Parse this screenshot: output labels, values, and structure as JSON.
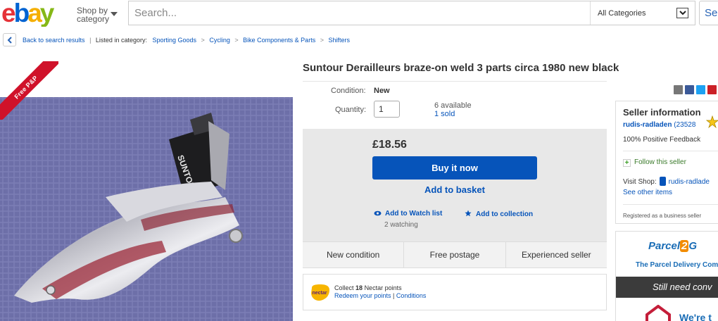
{
  "header": {
    "shop_by_line1": "Shop by",
    "shop_by_line2": "category",
    "search_placeholder": "Search...",
    "category_select": "All Categories",
    "search_button": "Se"
  },
  "breadcrumb": {
    "back_label": "Back to search results",
    "listed_in": "Listed in category:",
    "categories": [
      "Sporting Goods",
      "Cycling",
      "Bike Components & Parts",
      "Shifters"
    ]
  },
  "product": {
    "free_shipping_badge": "Free P&P",
    "title": "Suntour Derailleurs braze-on weld 3 parts circa 1980 new black",
    "condition_label": "Condition:",
    "condition_value": "New",
    "quantity_label": "Quantity:",
    "quantity_value": "1",
    "available": "6 available",
    "sold": "1 sold",
    "price": "£18.56",
    "buy_now": "Buy it now",
    "add_to_basket": "Add to basket",
    "watch_list": "Add to Watch list",
    "watching": "2 watching",
    "add_collection": "Add to collection",
    "features": [
      "New condition",
      "Free postage",
      "Experienced seller"
    ],
    "nectar_logo": "nectar",
    "nectar_collect_pre": "Collect",
    "nectar_points": "18",
    "nectar_collect_post": "Nectar points",
    "nectar_redeem": "Redeem your points",
    "nectar_conditions": "Conditions",
    "photo_brand": "SUNTOUR"
  },
  "seller": {
    "title": "Seller information",
    "name": "rudis-radladen",
    "score": "(23528",
    "feedback": "100% Positive Feedback",
    "follow": "Follow this seller",
    "visit_shop": "Visit Shop:",
    "shop_name": "rudis-radlade",
    "other_items": "See other items",
    "registered": "Registered as a business seller"
  },
  "ad": {
    "logo_pre": "Parcel",
    "logo_two": "2",
    "logo_post": "G",
    "tagline": "The Parcel Delivery Com",
    "dark_text": "Still need conv",
    "bottom_text": "We're t"
  },
  "colors": {
    "ebay_red": "#e53238",
    "ebay_blue": "#0064d2",
    "ebay_yellow": "#f5af02",
    "ebay_green": "#86b817",
    "link": "#0654ba",
    "buy_button": "#0654ba",
    "badge": "#d0122a"
  }
}
